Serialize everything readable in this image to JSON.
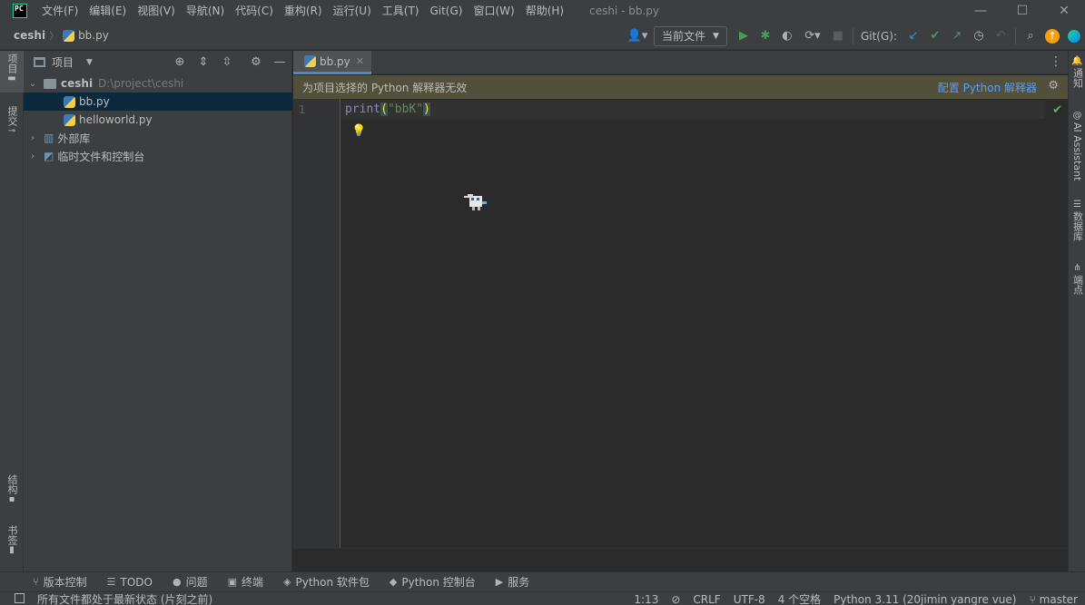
{
  "app": {
    "logo_text": "PC",
    "window_title": "ceshi - bb.py"
  },
  "menu": [
    "文件(F)",
    "编辑(E)",
    "视图(V)",
    "导航(N)",
    "代码(C)",
    "重构(R)",
    "运行(U)",
    "工具(T)",
    "Git(G)",
    "窗口(W)",
    "帮助(H)"
  ],
  "window_controls": {
    "minimize": "—",
    "maximize": "☐",
    "close": "✕"
  },
  "breadcrumb": {
    "project": "ceshi",
    "file": "bb.py"
  },
  "toolbar": {
    "run_config": "当前文件",
    "git_label": "Git(G):"
  },
  "left_stripe": {
    "project": "项目",
    "commit": "提交",
    "structure": "结构",
    "bookmarks": "书签"
  },
  "project_panel": {
    "title": "项目",
    "tree": [
      {
        "label": "ceshi",
        "path": "D:\\project\\ceshi",
        "type": "folder",
        "expanded": true
      },
      {
        "label": "bb.py",
        "type": "python",
        "selected": true
      },
      {
        "label": "helloworld.py",
        "type": "python"
      },
      {
        "label": "外部库",
        "type": "library"
      },
      {
        "label": "临时文件和控制台",
        "type": "scratch"
      }
    ]
  },
  "editor": {
    "tab_label": "bb.py",
    "banner_text": "为项目选择的 Python 解释器无效",
    "banner_link": "配置 Python 解释器",
    "line_number": "1",
    "code": {
      "fn": "print",
      "open": "(",
      "str": "\"bbK\"",
      "close": ")"
    }
  },
  "right_stripe": {
    "notifications": "通知",
    "ai": "AI Assistant",
    "database": "数据库",
    "endpoints": "端点"
  },
  "tool_windows": [
    "版本控制",
    "TODO",
    "问题",
    "终端",
    "Python 软件包",
    "Python 控制台",
    "服务"
  ],
  "status": {
    "message": "所有文件都处于最新状态 (片刻之前)",
    "position": "1:13",
    "line_ending": "CRLF",
    "encoding": "UTF-8",
    "indent": "4 个空格",
    "interpreter": "Python 3.11 (20jimin yangre vue)",
    "branch": "master"
  },
  "colors": {
    "accent": "#4a88c7",
    "banner_bg": "#52503a",
    "link": "#589df6",
    "run_green": "#499c54"
  }
}
